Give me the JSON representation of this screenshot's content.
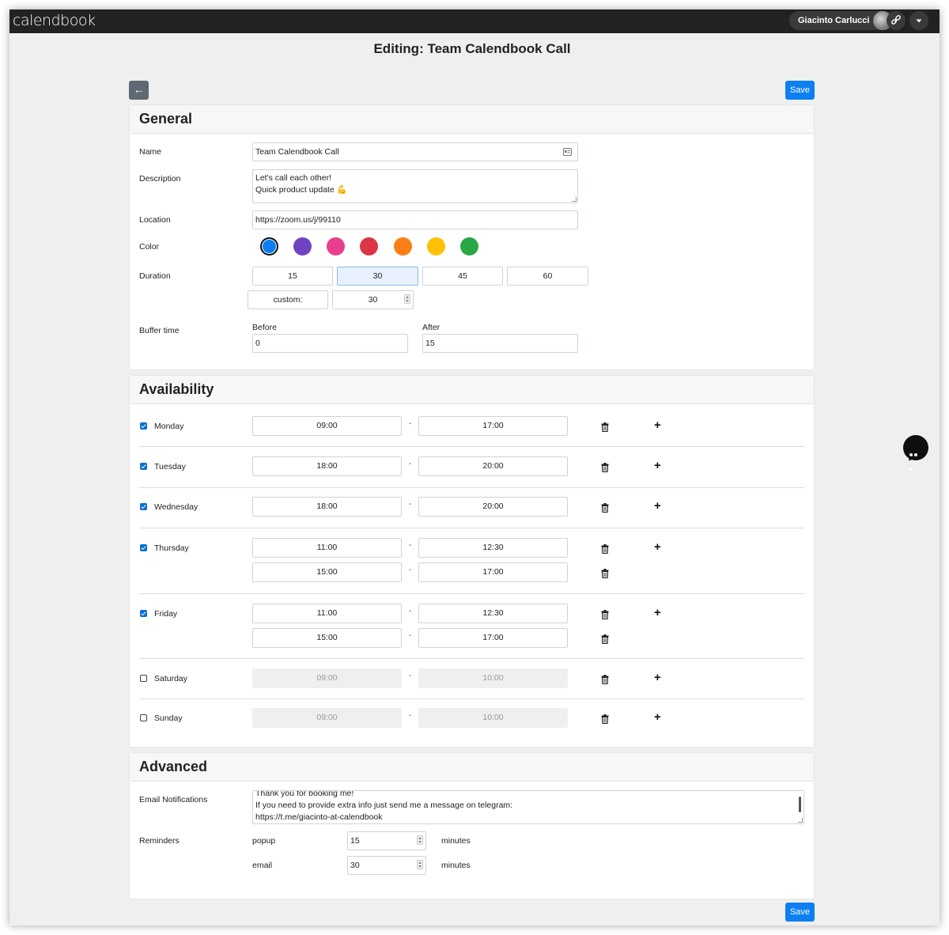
{
  "app": {
    "logo": "calendbook",
    "user_name": "Giacinto Carlucci"
  },
  "page": {
    "title": "Editing: Team Calendbook Call",
    "back_label": "←",
    "save_label": "Save"
  },
  "general": {
    "title": "General",
    "name_label": "Name",
    "name_value": "Team Calendbook Call",
    "description_label": "Description",
    "description_lines": [
      "Let's call each other!",
      "Quick product update 💪"
    ],
    "location_label": "Location",
    "location_value": "https://zoom.us/j/99110",
    "color_label": "Color",
    "colors": [
      "#0d7ff2",
      "#6f42c1",
      "#e83e8c",
      "#dc3545",
      "#fd7e14",
      "#ffc107",
      "#28a745"
    ],
    "selected_color": "#0d7ff2",
    "duration_label": "Duration",
    "durations": [
      "15",
      "30",
      "45",
      "60"
    ],
    "selected_duration": "30",
    "custom_label": "custom:",
    "custom_value": "30",
    "buffer_label": "Buffer time",
    "before_label": "Before",
    "before_value": "0",
    "after_label": "After",
    "after_value": "15"
  },
  "availability": {
    "title": "Availability",
    "dash": "-",
    "days": [
      {
        "name": "Monday",
        "enabled": true,
        "slots": [
          [
            "09:00",
            "17:00"
          ]
        ]
      },
      {
        "name": "Tuesday",
        "enabled": true,
        "slots": [
          [
            "18:00",
            "20:00"
          ]
        ]
      },
      {
        "name": "Wednesday",
        "enabled": true,
        "slots": [
          [
            "18:00",
            "20:00"
          ]
        ]
      },
      {
        "name": "Thursday",
        "enabled": true,
        "slots": [
          [
            "11:00",
            "12:30"
          ],
          [
            "15:00",
            "17:00"
          ]
        ]
      },
      {
        "name": "Friday",
        "enabled": true,
        "slots": [
          [
            "11:00",
            "12:30"
          ],
          [
            "15:00",
            "17:00"
          ]
        ]
      },
      {
        "name": "Saturday",
        "enabled": false,
        "slots": [
          [
            "09:00",
            "10:00"
          ]
        ]
      },
      {
        "name": "Sunday",
        "enabled": false,
        "slots": [
          [
            "09:00",
            "10:00"
          ]
        ]
      }
    ]
  },
  "advanced": {
    "title": "Advanced",
    "email_notifications_label": "Email Notifications",
    "email_notifications_lines": [
      "Thank you for booking me!",
      "If you need to provide extra info just send me a message on telegram:",
      "https://t.me/giacinto-at-calendbook"
    ],
    "reminders_label": "Reminders",
    "reminders": [
      {
        "type": "popup",
        "value": "15",
        "unit": "minutes"
      },
      {
        "type": "email",
        "value": "30",
        "unit": "minutes"
      }
    ]
  },
  "icons": {
    "link": "link-icon",
    "dropdown": "caret-down-icon",
    "trash": "trash-icon",
    "add": "plus-icon",
    "chat": "chat-bubble-icon",
    "contact_card": "contact-card-icon"
  }
}
